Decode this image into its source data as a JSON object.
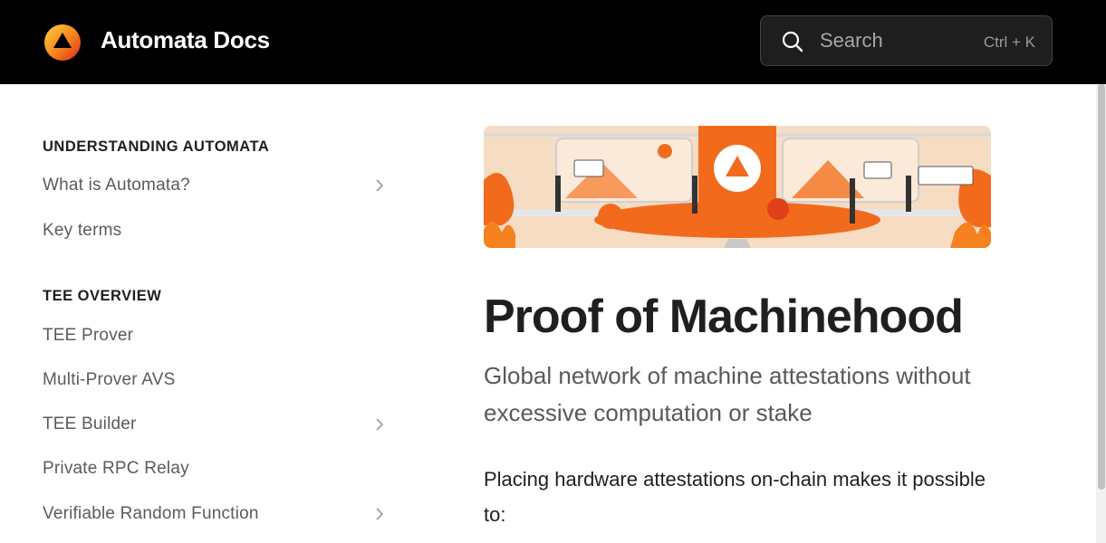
{
  "header": {
    "brand": "Automata Docs",
    "search": {
      "placeholder": "Search",
      "shortcut": "Ctrl + K"
    }
  },
  "sidebar": {
    "sections": [
      {
        "title": "UNDERSTANDING AUTOMATA",
        "items": [
          {
            "label": "What is Automata?",
            "expandable": true
          },
          {
            "label": "Key terms",
            "expandable": false
          }
        ]
      },
      {
        "title": "TEE OVERVIEW",
        "items": [
          {
            "label": "TEE Prover",
            "expandable": false
          },
          {
            "label": "Multi-Prover AVS",
            "expandable": false
          },
          {
            "label": "TEE Builder",
            "expandable": true
          },
          {
            "label": "Private RPC Relay",
            "expandable": false
          },
          {
            "label": "Verifiable Random Function",
            "expandable": true
          }
        ]
      }
    ]
  },
  "main": {
    "title": "Proof of Machinehood",
    "subtitle": "Global network of machine attestations without excessive computation or stake",
    "body": "Placing hardware attestations on-chain makes it possible to:"
  },
  "colors": {
    "topbar": "#000000",
    "accent": "#f26b1d",
    "hero_background": "#f7dcc4"
  }
}
